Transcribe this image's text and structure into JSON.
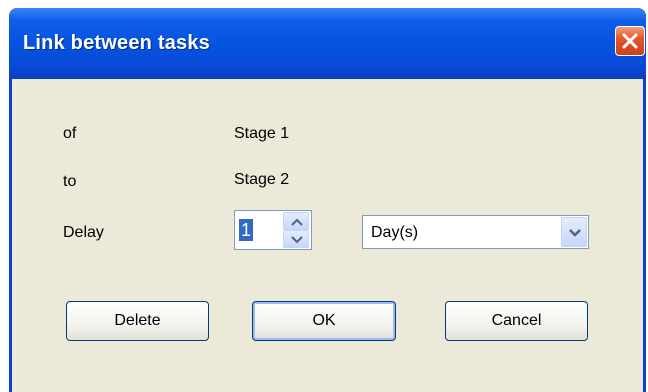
{
  "window": {
    "title": "Link between tasks",
    "close_icon": "close-x-icon"
  },
  "form": {
    "of_label": "of",
    "of_value": "Stage 1",
    "to_label": "to",
    "to_value": "Stage 2",
    "delay_label": "Delay",
    "delay_value": "1",
    "unit_value": "Day(s)"
  },
  "buttons": {
    "delete": "Delete",
    "ok": "OK",
    "cancel": "Cancel"
  },
  "colors": {
    "titlebar": "#0453e0",
    "client": "#ece9d8",
    "close": "#e2582a",
    "selection": "#316ac5"
  }
}
